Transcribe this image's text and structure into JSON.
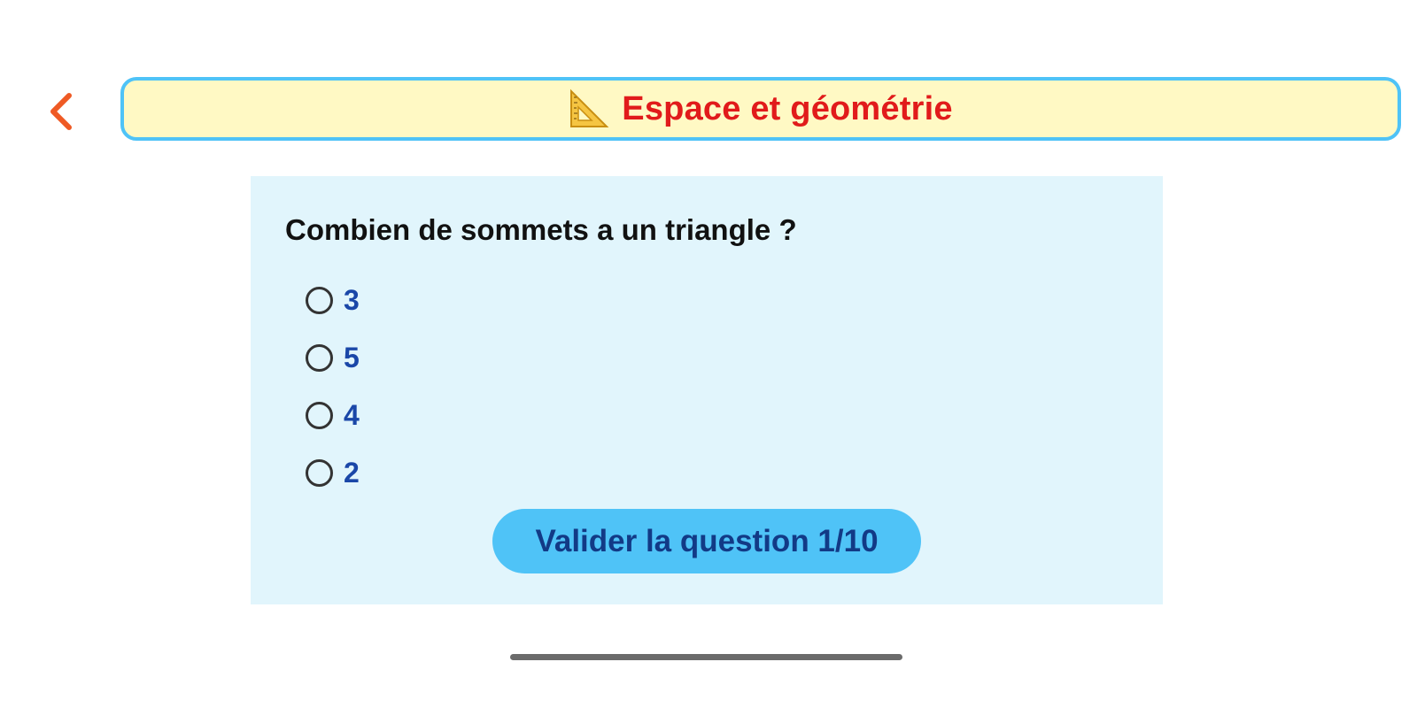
{
  "header": {
    "title": "Espace et géométrie",
    "icon": "triangle-ruler-icon",
    "title_color": "#e11b1b",
    "background": "#fff9c4",
    "border_color": "#4fc3f7"
  },
  "nav": {
    "back_icon": "chevron-left-icon",
    "back_color": "#ef5a24"
  },
  "quiz": {
    "question": "Combien de sommets a un triangle ?",
    "options": [
      {
        "label": "3",
        "selected": false
      },
      {
        "label": "5",
        "selected": false
      },
      {
        "label": "4",
        "selected": false
      },
      {
        "label": "2",
        "selected": false
      }
    ],
    "validate_label": "Valider la question 1/10",
    "card_background": "#e1f5fc",
    "button_color": "#4fc3f7"
  }
}
